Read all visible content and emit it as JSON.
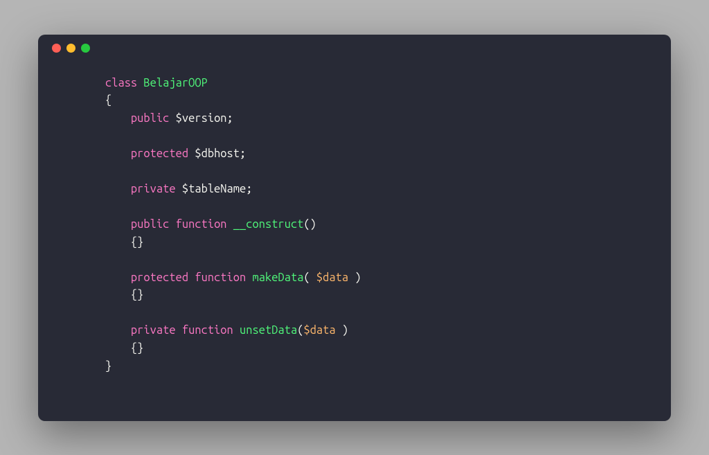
{
  "code": {
    "indent1": "    ",
    "indent2": "        ",
    "line1_class": "class",
    "line1_name": "BelajarOOP",
    "brace_open": "{",
    "brace_close": "}",
    "empty_braces": "{}",
    "prop1_vis": "public",
    "prop1_var": "$version",
    "prop2_vis": "protected",
    "prop2_var": "$dbhost",
    "prop3_vis": "private",
    "prop3_var": "$tableName",
    "semicolon": ";",
    "func_kw": "function",
    "method1_vis": "public",
    "method1_name": "__construct",
    "method1_params": "()",
    "method2_vis": "protected",
    "method2_name": "makeData",
    "method2_open": "(",
    "method2_param": " $data ",
    "method2_close": ")",
    "method3_vis": "private",
    "method3_name": "unsetData",
    "method3_open": "(",
    "method3_param": "$data ",
    "method3_close": ")"
  }
}
